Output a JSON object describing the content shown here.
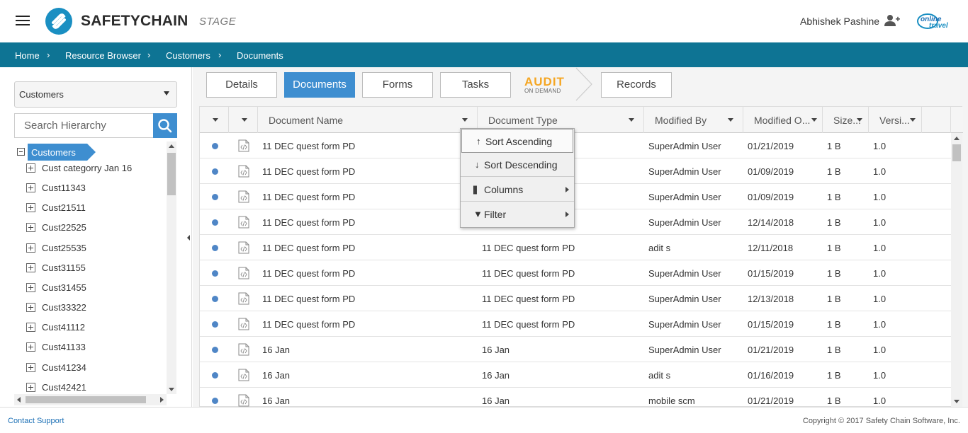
{
  "header": {
    "app_name": "SAFETYCHAIN",
    "environment": "STAGE",
    "user_name": "Abhishek Pashine",
    "brand_logo_text": "online travel"
  },
  "breadcrumb": [
    "Home",
    "Resource Browser",
    "Customers",
    "Documents"
  ],
  "sidebar": {
    "dropdown_value": "Customers",
    "search_placeholder": "Search Hierarchy",
    "root_label": "Customers",
    "items": [
      "Cust categorry Jan 16",
      "Cust11343",
      "Cust21511",
      "Cust22525",
      "Cust25535",
      "Cust31155",
      "Cust31455",
      "Cust33322",
      "Cust41112",
      "Cust41133",
      "Cust41234",
      "Cust42421"
    ]
  },
  "tabs": {
    "details": "Details",
    "documents": "Documents",
    "forms": "Forms",
    "tasks": "Tasks",
    "audit_main": "AUDIT",
    "audit_sub": "ON DEMAND",
    "records": "Records"
  },
  "grid": {
    "columns": {
      "name": "Document Name",
      "type": "Document Type",
      "modified_by": "Modified By",
      "modified_on": "Modified O...",
      "size": "Size...",
      "version": "Versi..."
    },
    "rows": [
      {
        "name": "11 DEC quest form PD",
        "type": "",
        "modified_by": "SuperAdmin User",
        "modified_on": "01/21/2019",
        "size": "1 B",
        "version": "1.0"
      },
      {
        "name": "11 DEC quest form PD",
        "type": "",
        "modified_by": "SuperAdmin User",
        "modified_on": "01/09/2019",
        "size": "1 B",
        "version": "1.0"
      },
      {
        "name": "11 DEC quest form PD",
        "type": "",
        "modified_by": "SuperAdmin User",
        "modified_on": "01/09/2019",
        "size": "1 B",
        "version": "1.0"
      },
      {
        "name": "11 DEC quest form PD",
        "type": "",
        "modified_by": "SuperAdmin User",
        "modified_on": "12/14/2018",
        "size": "1 B",
        "version": "1.0"
      },
      {
        "name": "11 DEC quest form PD",
        "type": "11 DEC quest form PD",
        "modified_by": "adit s",
        "modified_on": "12/11/2018",
        "size": "1 B",
        "version": "1.0"
      },
      {
        "name": "11 DEC quest form PD",
        "type": "11 DEC quest form PD",
        "modified_by": "SuperAdmin User",
        "modified_on": "01/15/2019",
        "size": "1 B",
        "version": "1.0"
      },
      {
        "name": "11 DEC quest form PD",
        "type": "11 DEC quest form PD",
        "modified_by": "SuperAdmin User",
        "modified_on": "12/13/2018",
        "size": "1 B",
        "version": "1.0"
      },
      {
        "name": "11 DEC quest form PD",
        "type": "11 DEC quest form PD",
        "modified_by": "SuperAdmin User",
        "modified_on": "01/15/2019",
        "size": "1 B",
        "version": "1.0"
      },
      {
        "name": "16 Jan",
        "type": "16 Jan",
        "modified_by": "SuperAdmin User",
        "modified_on": "01/21/2019",
        "size": "1 B",
        "version": "1.0"
      },
      {
        "name": "16 Jan",
        "type": "16 Jan",
        "modified_by": "adit s",
        "modified_on": "01/16/2019",
        "size": "1 B",
        "version": "1.0"
      },
      {
        "name": "16 Jan",
        "type": "16 Jan",
        "modified_by": "mobile scm",
        "modified_on": "01/21/2019",
        "size": "1 B",
        "version": "1.0"
      }
    ]
  },
  "context_menu": {
    "sort_asc": "Sort Ascending",
    "sort_desc": "Sort Descending",
    "columns": "Columns",
    "filter": "Filter",
    "icons": {
      "sort_asc": "↑",
      "sort_desc": "↓",
      "columns": "|||",
      "filter": "▼"
    }
  },
  "footer": {
    "support": "Contact Support",
    "copyright": "Copyright © 2017 Safety Chain Software, Inc."
  },
  "colors": {
    "accent": "#3e8ed0",
    "breadcrumb_bg": "#0e7494",
    "audit_orange": "#f5a623",
    "status_dot": "#4f86c6"
  }
}
